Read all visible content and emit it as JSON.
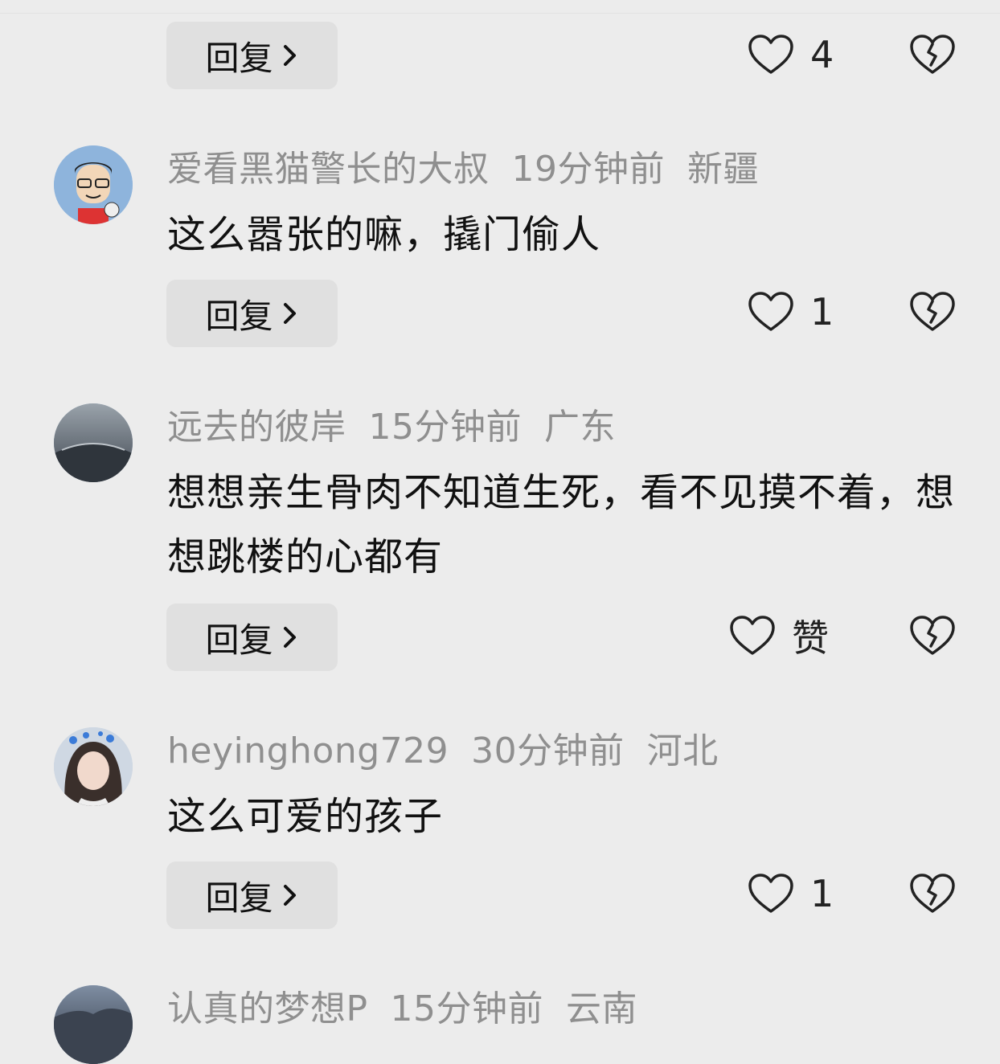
{
  "first_item": {
    "reply_label": "回复",
    "like_count": "4"
  },
  "comments": [
    {
      "username": "爱看黑猫警长的大叔",
      "time": "19分钟前",
      "location": "新疆",
      "text": "这么嚣张的嘛，撬门偷人",
      "reply_label": "回复",
      "like_count": "1"
    },
    {
      "username": "远去的彼岸",
      "time": "15分钟前",
      "location": "广东",
      "text": "想想亲生骨肉不知道生死，看不见摸不着，想想跳楼的心都有",
      "reply_label": "回复",
      "like_count": "赞"
    },
    {
      "username": "heyinghong729",
      "time": "30分钟前",
      "location": "河北",
      "text": "这么可爱的孩子",
      "reply_label": "回复",
      "like_count": "1"
    },
    {
      "username": "认真的梦想P",
      "time": "15分钟前",
      "location": "云南"
    }
  ],
  "colors": {
    "background": "#ececec",
    "meta_text": "#8f8f8f",
    "button_bg": "#e0e0e0"
  }
}
